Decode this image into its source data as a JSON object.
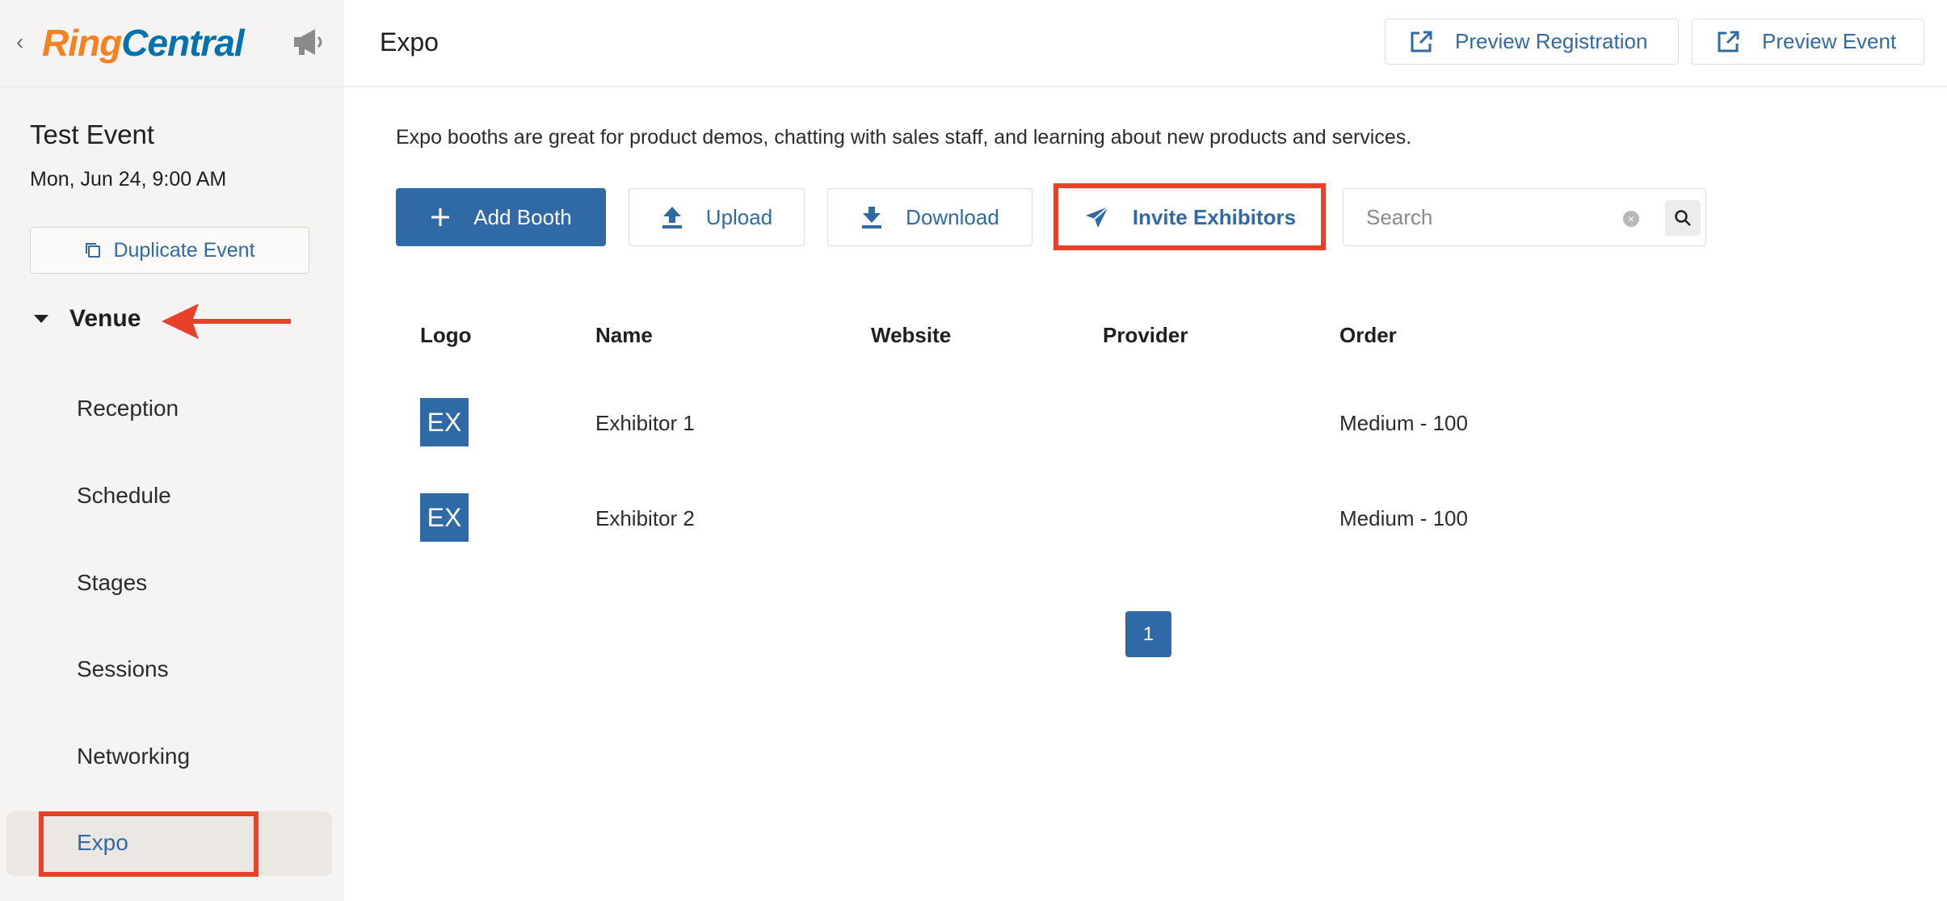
{
  "sidebar": {
    "logo": {
      "part1": "Ring",
      "part2": "Central"
    },
    "event_title": "Test Event",
    "event_date": "Mon, Jun 24, 9:00 AM",
    "duplicate_label": "Duplicate Event",
    "venue_label": "Venue",
    "items": [
      {
        "label": "Reception"
      },
      {
        "label": "Schedule"
      },
      {
        "label": "Stages"
      },
      {
        "label": "Sessions"
      },
      {
        "label": "Networking"
      },
      {
        "label": "Expo"
      }
    ],
    "active_item": "Expo"
  },
  "header": {
    "title": "Expo",
    "preview_registration": "Preview Registration",
    "preview_event": "Preview Event"
  },
  "main": {
    "description": "Expo booths are great for product demos, chatting with sales staff, and learning about new products and services.",
    "toolbar": {
      "add_booth": "Add Booth",
      "upload": "Upload",
      "download": "Download",
      "invite_exhibitors": "Invite Exhibitors",
      "search_placeholder": "Search"
    },
    "table": {
      "columns": [
        "Logo",
        "Name",
        "Website",
        "Provider",
        "Order"
      ],
      "rows": [
        {
          "logo": "EX",
          "name": "Exhibitor 1",
          "website": "",
          "provider": "",
          "order": "Medium - 100"
        },
        {
          "logo": "EX",
          "name": "Exhibitor 2",
          "website": "",
          "provider": "",
          "order": "Medium - 100"
        }
      ]
    },
    "pagination": {
      "current_page": "1"
    }
  },
  "colors": {
    "accent": "#2f6aa7",
    "annotation": "#e8412a",
    "logo_orange": "#f58220",
    "logo_blue": "#0073ae"
  },
  "icons": {
    "back": "chevron-left-icon",
    "announcements": "megaphone-icon",
    "duplicate": "copy-icon",
    "external": "external-link-icon",
    "add": "plus-icon",
    "upload": "upload-icon",
    "download": "download-icon",
    "invite": "paper-plane-icon",
    "clear": "clear-icon",
    "search": "search-icon"
  }
}
